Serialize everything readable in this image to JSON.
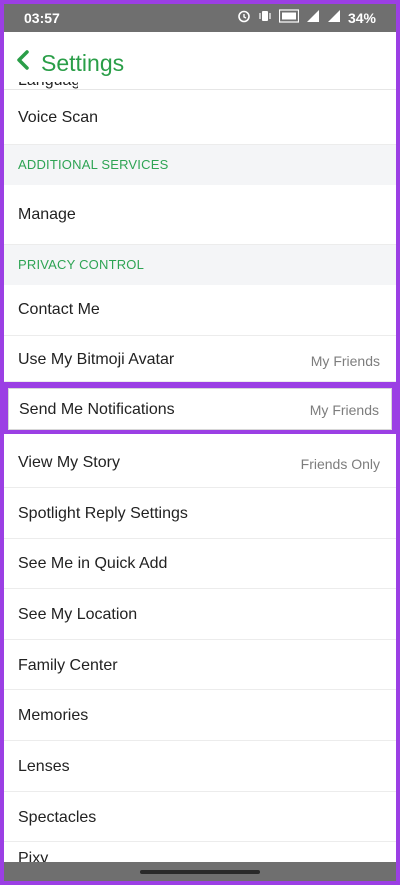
{
  "status_bar": {
    "time": "03:57",
    "battery": "34%"
  },
  "header": {
    "title": "Settings",
    "cut_row_label": "Languages"
  },
  "rows": {
    "voice_scan": "Voice Scan",
    "manage": "Manage",
    "contact_me": "Contact Me",
    "bitmoji": {
      "label": "Use My Bitmoji Avatar",
      "value": "My Friends"
    },
    "notifications": {
      "label": "Send Me Notifications",
      "value": "My Friends"
    },
    "story": {
      "label": "View My Story",
      "value": "Friends Only"
    },
    "spotlight": "Spotlight Reply Settings",
    "quick_add": "See Me in Quick Add",
    "location": "See My Location",
    "family": "Family Center",
    "memories": "Memories",
    "lenses": "Lenses",
    "spectacles": "Spectacles",
    "pixy": "Pixy"
  },
  "sections": {
    "additional": "ADDITIONAL SERVICES",
    "privacy": "PRIVACY CONTROL"
  },
  "colors": {
    "accent": "#2a9e48",
    "highlight": "#9b3fe4"
  }
}
